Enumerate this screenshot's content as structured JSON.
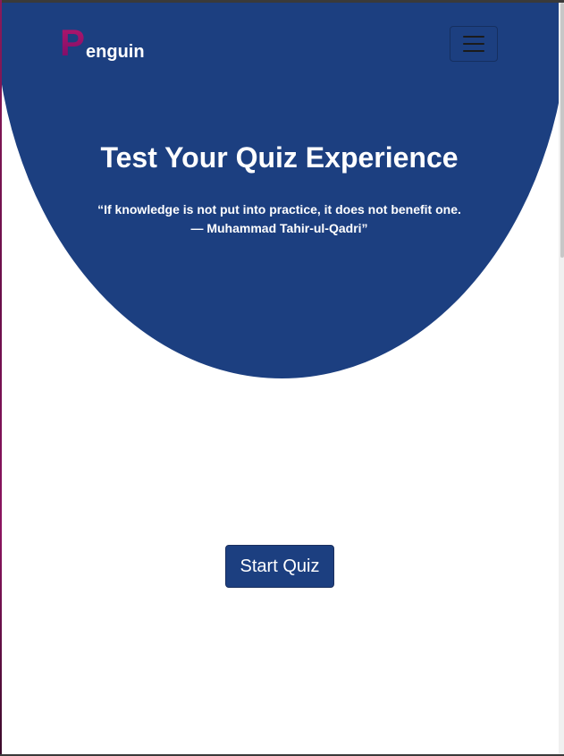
{
  "navbar": {
    "brand_initial": "P",
    "brand_rest": "enguin",
    "toggle_icon": "hamburger-icon"
  },
  "hero": {
    "title": "Test Your Quiz Experience",
    "quote_line1": "“If knowledge is not put into practice, it does not benefit one.",
    "quote_line2": "— Muhammad Tahir-ul-Qadri”"
  },
  "actions": {
    "start_label": "Start Quiz"
  },
  "colors": {
    "hero_background": "#1c3f80",
    "brand_accent": "#b1176b",
    "button_background": "#1c3f80",
    "page_background": "#ffffff"
  }
}
